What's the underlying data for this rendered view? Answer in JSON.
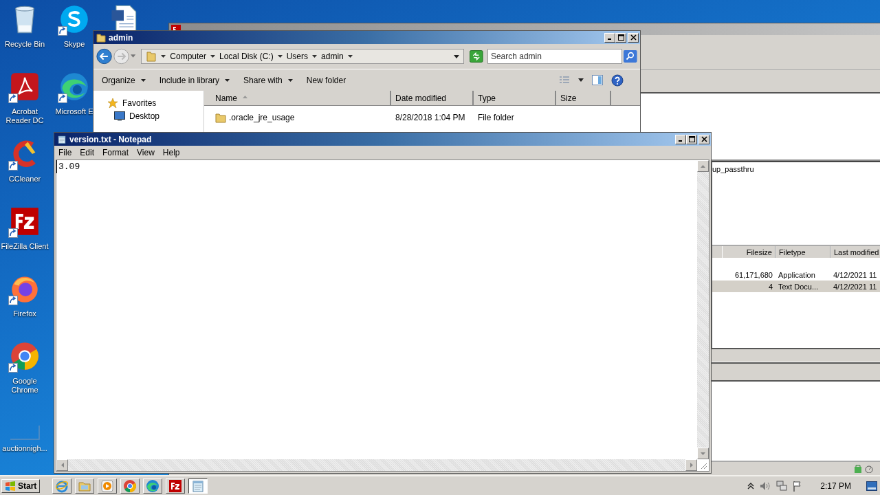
{
  "desktop": {
    "columns": [
      [
        {
          "kind": "recycle-bin",
          "label": "Recycle Bin",
          "shortcut": false
        },
        {
          "kind": "acrobat",
          "label": "Acrobat Reader DC",
          "shortcut": true
        },
        {
          "kind": "ccleaner",
          "label": "CCleaner",
          "shortcut": true
        },
        {
          "kind": "filezilla",
          "label": "FileZilla Client",
          "shortcut": true
        },
        {
          "kind": "firefox",
          "label": "Firefox",
          "shortcut": true
        },
        {
          "kind": "chrome",
          "label": "Google Chrome",
          "shortcut": true
        },
        {
          "kind": "blank",
          "label": "auctionnigh...",
          "shortcut": false
        }
      ],
      [
        {
          "kind": "skype",
          "label": "Skype",
          "shortcut": true
        },
        {
          "kind": "edge",
          "label": "Microsoft E",
          "shortcut": true
        }
      ],
      [
        {
          "kind": "document"
        }
      ]
    ]
  },
  "filezilla": {
    "remote_tree": [
      "up_passthru"
    ],
    "columns": [
      "Filesize",
      "Filetype",
      "Last modified"
    ],
    "rows": [
      {
        "filesize": "61,171,680",
        "filetype": "Application",
        "modified": "4/12/2021 11",
        "selected": false
      },
      {
        "filesize": "4",
        "filetype": "Text Docu...",
        "modified": "4/12/2021 11",
        "selected": true
      }
    ]
  },
  "explorer": {
    "title": "admin",
    "breadcrumb": [
      "Computer",
      "Local Disk (C:)",
      "Users",
      "admin"
    ],
    "search": {
      "placeholder": "Search admin"
    },
    "toolbar": [
      {
        "label": "Organize",
        "dropdown": true
      },
      {
        "label": "Include in library",
        "dropdown": true
      },
      {
        "label": "Share with",
        "dropdown": true
      },
      {
        "label": "New folder",
        "dropdown": false
      }
    ],
    "nav": [
      {
        "kind": "favorites",
        "label": "Favorites"
      },
      {
        "kind": "desktop",
        "label": "Desktop"
      }
    ],
    "columns": [
      {
        "label": "Name",
        "sorted": true
      },
      {
        "label": "Date modified",
        "sorted": false
      },
      {
        "label": "Type",
        "sorted": false
      },
      {
        "label": "Size",
        "sorted": false
      }
    ],
    "rows": [
      {
        "name": ".oracle_jre_usage",
        "date": "8/28/2018 1:04 PM",
        "type": "File folder"
      }
    ]
  },
  "notepad": {
    "title": "version.txt - Notepad",
    "menu": [
      "File",
      "Edit",
      "Format",
      "View",
      "Help"
    ],
    "text": "3.09"
  },
  "taskbar": {
    "start": "Start",
    "apps": [
      {
        "kind": "ie",
        "selected": false
      },
      {
        "kind": "explorer",
        "selected": false
      },
      {
        "kind": "media",
        "selected": false
      },
      {
        "kind": "chrome",
        "selected": false
      },
      {
        "kind": "edge",
        "selected": false
      },
      {
        "kind": "filezilla",
        "selected": false
      },
      {
        "kind": "notepad",
        "selected": true
      }
    ],
    "clock": "2:17 PM"
  }
}
